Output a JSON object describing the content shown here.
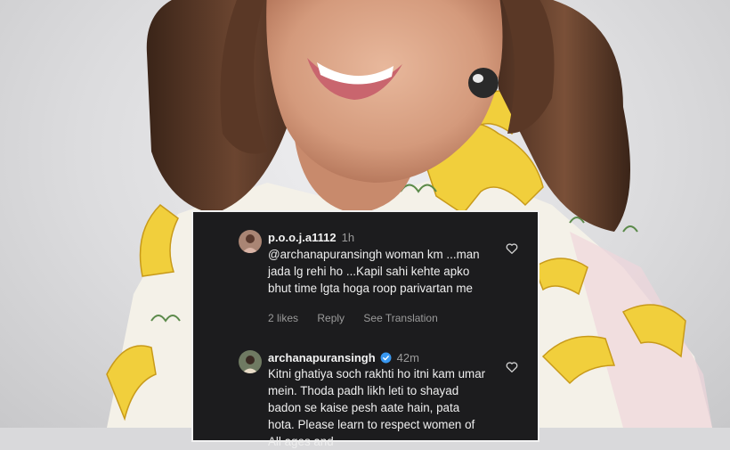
{
  "comments": [
    {
      "username": "p.o.o.j.a1112",
      "time": "1h",
      "text": "@archanapuransingh woman km ...man jada lg rehi ho ...Kapil sahi kehte apko bhut time lgta hoga roop parivartan me",
      "likes": "2 likes",
      "reply": "Reply",
      "see_translation": "See Translation",
      "avatar_icon": "profile-avatar-icon",
      "like_icon": "heart-outline-icon"
    },
    {
      "username": "archanapuransingh",
      "time": "42m",
      "verified": true,
      "verified_icon": "verified-badge-icon",
      "text": "Kitni ghatiya soch rakhti ho itni kam umar mein. Thoda padh likh leti to shayad badon se kaise pesh aate hain, pata hota. Please learn to respect women of All ages and",
      "avatar_icon": "profile-avatar-icon",
      "like_icon": "heart-outline-icon"
    }
  ],
  "colors": {
    "card_background": "#1c1c1e",
    "card_border": "#f2f2f2",
    "text_primary": "#f2f2f2",
    "text_secondary": "#9a9a9a",
    "verified_blue": "#3897f0"
  }
}
